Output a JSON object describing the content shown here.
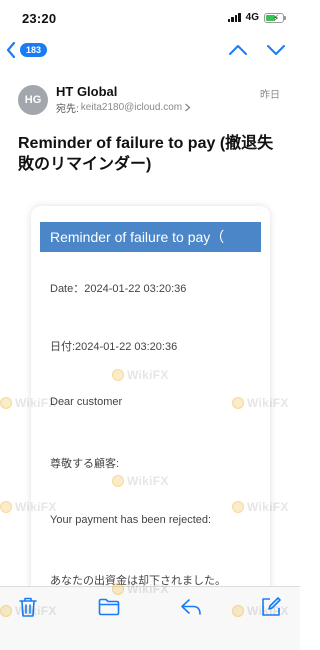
{
  "status_bar": {
    "time": "23:20",
    "network": "4G"
  },
  "nav": {
    "unread_count": "183"
  },
  "sender": {
    "initials": "HG",
    "name": "HT Global",
    "to_label": "宛先:",
    "to_address": "keita2180@icloud.com",
    "time": "昨日"
  },
  "email": {
    "subject": "Reminder of failure to pay (撤退失敗のリマインダー)",
    "banner": "Reminder of failure to pay（",
    "lines": [
      "Date：2024-01-22 03:20:36",
      "日付:2024-01-22 03:20:36",
      "Dear customer",
      "尊敬する顧客:",
      "Your payment has been rejected:",
      "あなたの出資金は却下されました。"
    ]
  },
  "watermark": "WikiFX",
  "colors": {
    "accent": "#1a7cf5",
    "banner": "#4a86c8",
    "battery": "#3bc05a"
  },
  "toolbar": {
    "icons": [
      "trash-icon",
      "folder-icon",
      "reply-icon",
      "compose-icon"
    ]
  }
}
